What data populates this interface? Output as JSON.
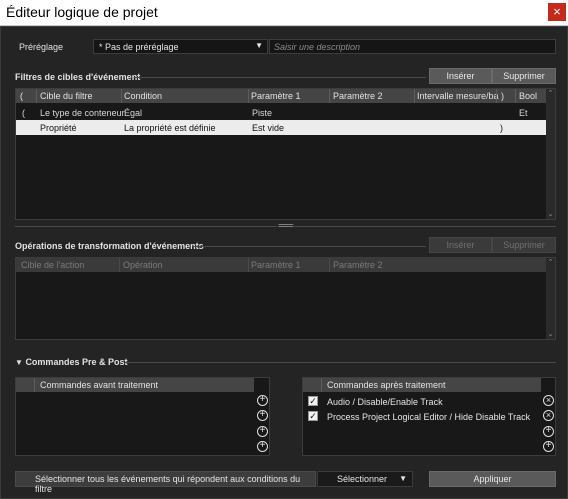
{
  "window": {
    "title": "Éditeur logique de projet",
    "close_glyph": "×"
  },
  "preset": {
    "label": "Préréglage",
    "selected": "* Pas de préréglage",
    "description_placeholder": "Saisir une description"
  },
  "filters": {
    "section_title": "Filtres de cibles d'événement",
    "insert_label": "Insérer",
    "delete_label": "Supprimer",
    "columns": [
      "(",
      "Cible du filtre",
      "Condition",
      "Paramètre 1",
      "Paramètre 2",
      "Intervalle mesure/ba",
      ")",
      "Bool"
    ],
    "rows": [
      {
        "open": "(",
        "target": "Le type de conteneur",
        "condition": "Égal",
        "param1": "Piste",
        "param2": "",
        "range": "",
        "close": "",
        "bool": "Et"
      },
      {
        "open": "",
        "target": "Propriété",
        "condition": "La propriété est définie",
        "param1": "Est vide",
        "param2": "",
        "range": "",
        "close": ")",
        "bool": ""
      }
    ]
  },
  "operations": {
    "section_title": "Opérations de transformation d'événements",
    "insert_label": "Insérer",
    "delete_label": "Supprimer",
    "columns": [
      "Cible de l'action",
      "Opération",
      "Paramètre 1",
      "Paramètre 2"
    ]
  },
  "prepost": {
    "section_title": "Commandes Pre & Post",
    "before_title": "Commandes avant traitement",
    "after_title": "Commandes après traitement",
    "after_items": [
      {
        "label": "Audio / Disable/Enable Track",
        "checked": true
      },
      {
        "label": "Process Project Logical Editor / Hide Disable Track",
        "checked": true
      }
    ]
  },
  "footer": {
    "select_all_label": "Sélectionner tous les événements qui répondent aux conditions du filtre",
    "action_selected": "Sélectionner",
    "apply_label": "Appliquer"
  },
  "colors": {
    "selected_row": "#ececec",
    "close_button": "#c42b1c"
  }
}
